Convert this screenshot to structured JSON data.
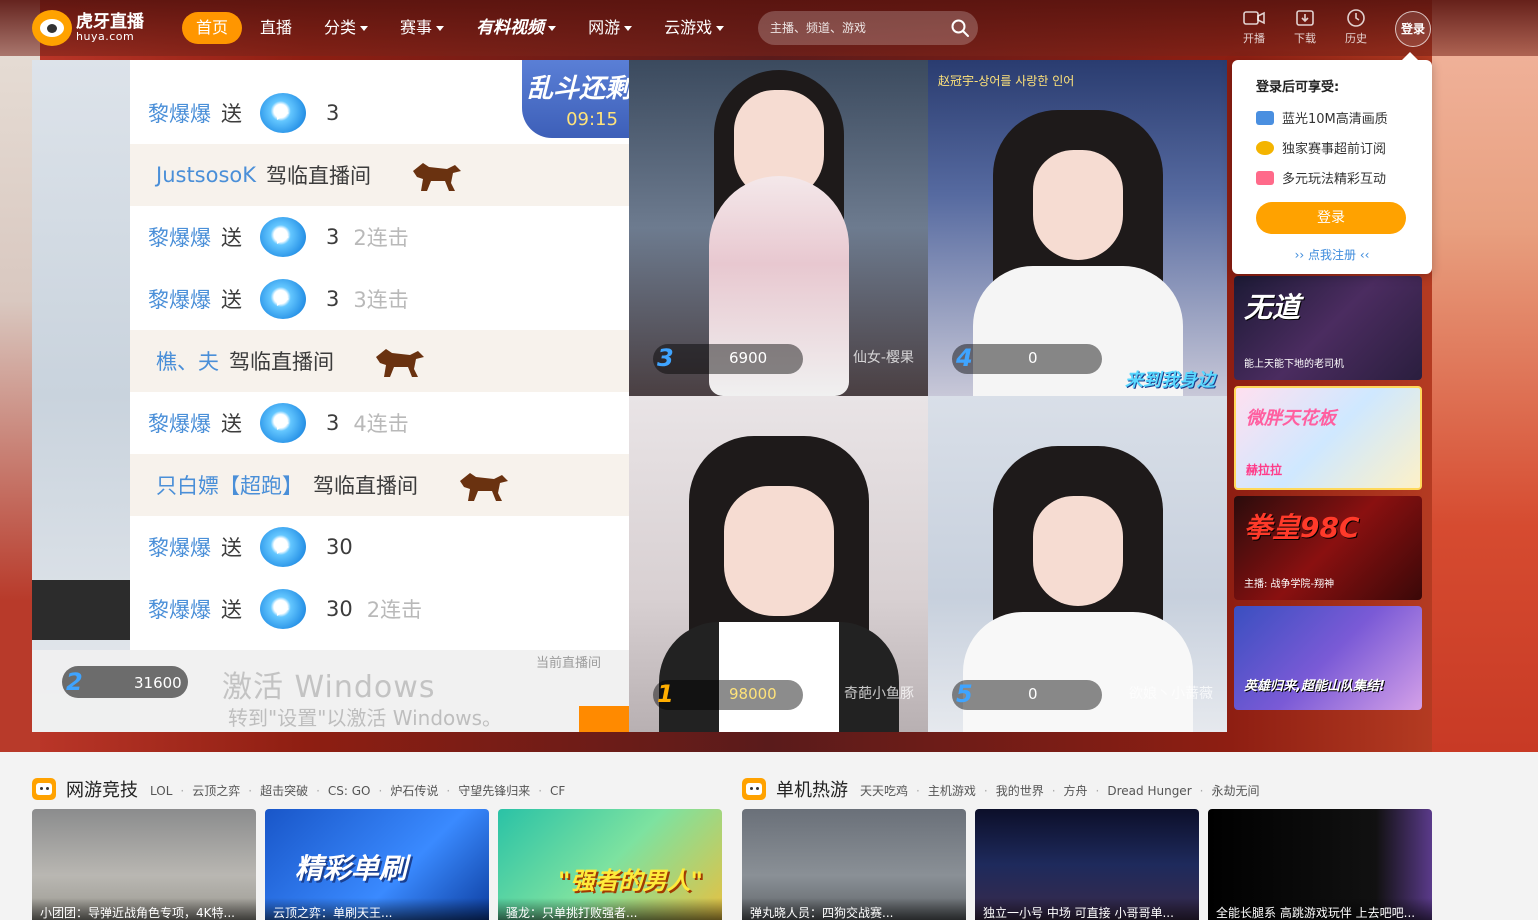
{
  "brand": {
    "name_cn": "虎牙直播",
    "name_en": "huya.com"
  },
  "nav": [
    {
      "label": "首页",
      "active": true,
      "dropdown": false
    },
    {
      "label": "直播",
      "active": false,
      "dropdown": false
    },
    {
      "label": "分类",
      "active": false,
      "dropdown": true
    },
    {
      "label": "赛事",
      "active": false,
      "dropdown": true
    },
    {
      "label": "有料视频",
      "active": false,
      "dropdown": true
    },
    {
      "label": "网游",
      "active": false,
      "dropdown": true
    },
    {
      "label": "云游戏",
      "active": false,
      "dropdown": true
    }
  ],
  "search": {
    "placeholder": "主播、频道、游戏",
    "value": ""
  },
  "tools": {
    "broadcast": "开播",
    "download": "下载",
    "history": "历史",
    "login": "登录"
  },
  "login_popup": {
    "title": "登录后可享受:",
    "perks": [
      "蓝光10M高清画质",
      "独家赛事超前订阅",
      "多元玩法精彩互动"
    ],
    "button": "登录",
    "register": "点我注册"
  },
  "player": {
    "battle_banner": {
      "title": "乱斗还剩余",
      "time": "09:15"
    },
    "chat": [
      {
        "type": "gift",
        "user": "黎爆爆",
        "verb": "送",
        "count": "3",
        "combo": ""
      },
      {
        "type": "enter",
        "user": "JustsosoK",
        "verb": "驾临直播间"
      },
      {
        "type": "gift",
        "user": "黎爆爆",
        "verb": "送",
        "count": "3",
        "combo": "2连击"
      },
      {
        "type": "gift",
        "user": "黎爆爆",
        "verb": "送",
        "count": "3",
        "combo": "3连击"
      },
      {
        "type": "enter",
        "user": "樵、夫",
        "verb": "驾临直播间"
      },
      {
        "type": "gift",
        "user": "黎爆爆",
        "verb": "送",
        "count": "3",
        "combo": "4连击"
      },
      {
        "type": "enter",
        "user": "只白嫖【超跑】",
        "verb": "驾临直播间"
      },
      {
        "type": "gift",
        "user": "黎爆爆",
        "verb": "送",
        "count": "30",
        "combo": ""
      },
      {
        "type": "gift",
        "user": "黎爆爆",
        "verb": "送",
        "count": "30",
        "combo": "2连击"
      }
    ],
    "cells": [
      {
        "rank": "3",
        "score": "6900",
        "name": "仙女-樱果"
      },
      {
        "rank": "4",
        "score": "0",
        "name": ""
      },
      {
        "rank": "1",
        "score": "98000",
        "name": "奇葩小鱼豚"
      },
      {
        "rank": "5",
        "score": "0",
        "name": "欲娘丶小蔷薇"
      }
    ],
    "cell4_overlay": "来到我身边",
    "cell4_top": "赵冠宇-상어를 사랑한 인어",
    "bottombar": {
      "rank": "2",
      "score": "31600",
      "watermark": "激活 Windows",
      "watermark_sub": "转到\"设置\"以激活 Windows。",
      "current": "当前直播间"
    }
  },
  "sidebar": [
    {
      "caption": "无道",
      "sub": "能上天能下地的老司机"
    },
    {
      "caption": "微胖天花板",
      "sub": "赫拉拉"
    },
    {
      "caption": "拳皇98C",
      "sub": "主播: 战争学院-翔神"
    },
    {
      "caption": "英雄归来,超能山队集结!",
      "sub": ""
    }
  ],
  "categories": [
    {
      "title": "网游竞技",
      "links": [
        "LOL",
        "云顶之弈",
        "超击突破",
        "CS: GO",
        "炉石传说",
        "守望先锋归来",
        "CF"
      ]
    },
    {
      "title": "单机热游",
      "links": [
        "天天吃鸡",
        "主机游戏",
        "我的世界",
        "方舟",
        "Dread Hunger",
        "永劫无间"
      ]
    }
  ],
  "thumbs_left": [
    {
      "big": "",
      "caption": "小团团：导弹近战角色专项，4K特..."
    },
    {
      "big": "精彩单刷",
      "caption": "云顶之弈：单刷天王..."
    },
    {
      "big": "\"强者的男人\"",
      "caption": "骚龙：只单挑打败强者..."
    }
  ],
  "thumbs_right": [
    {
      "big": "",
      "caption": "弹丸晓人员：四狗交战赛..."
    },
    {
      "big": "",
      "caption": "独立一小号 中场 可直接 小哥哥单..."
    },
    {
      "big": "",
      "caption": "全能长腿系 高跳游戏玩伴 上去吧吧..."
    }
  ]
}
